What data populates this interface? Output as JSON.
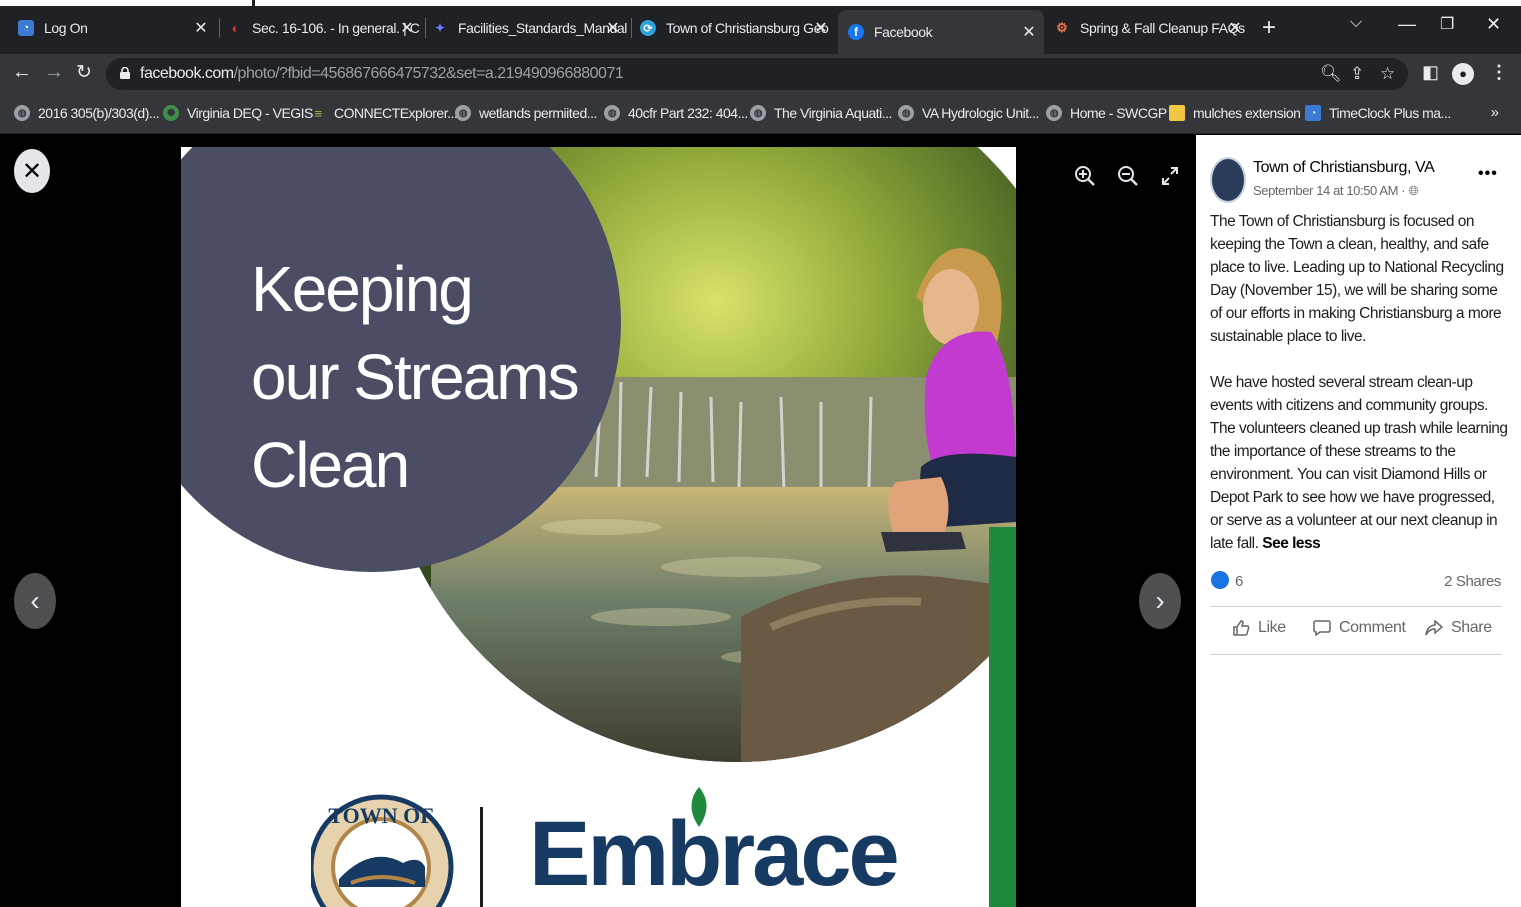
{
  "tabs": [
    {
      "label": "Log On",
      "favicon": "timeclock-icon",
      "active": false
    },
    {
      "label": "Sec. 16-106. - In general. | C",
      "favicon": "municode-icon",
      "active": false
    },
    {
      "label": "Facilities_Standards_Manual",
      "favicon": "document-icon",
      "active": false
    },
    {
      "label": "Town of Christiansburg Geo",
      "favicon": "geo-icon",
      "active": false
    },
    {
      "label": "Facebook",
      "favicon": "facebook-icon",
      "active": true
    },
    {
      "label": "Spring & Fall Cleanup FAQs",
      "favicon": "cleanup-icon",
      "active": false
    }
  ],
  "address": {
    "host": "facebook.com",
    "path": "/photo/?fbid=456867666475732&set=a.219490966880071"
  },
  "bookmarks": [
    {
      "label": "2016 305(b)/303(d)..."
    },
    {
      "label": "Virginia DEQ - VEGIS"
    },
    {
      "label": "CONNECTExplorer..."
    },
    {
      "label": "wetlands permiited..."
    },
    {
      "label": "40cfr Part 232: 404..."
    },
    {
      "label": "The Virginia Aquati..."
    },
    {
      "label": "VA Hydrologic Unit..."
    },
    {
      "label": "Home - SWCGP"
    },
    {
      "label": "mulches extension"
    },
    {
      "label": "TimeClock Plus ma..."
    }
  ],
  "photo": {
    "headline": [
      "Keeping",
      "our Streams",
      "Clean"
    ],
    "brand": "Embrace",
    "seal_text": "TOWN OF"
  },
  "post": {
    "page_name": "Town of Christiansburg, VA",
    "meta": "September 14 at 10:50 AM · ",
    "paragraph1": "The Town of Christiansburg is focused on keeping the Town a clean, healthy, and safe place to live. Leading up to National Recycling Day (November 15), we will be sharing some of our efforts in making Christiansburg a more sustainable place to live.",
    "paragraph2": "We have hosted several stream clean-up events with citizens and community groups. The volunteers cleaned up trash while learning the importance of these streams to the environment. You can visit Diamond Hills or Depot Park to see how we have progressed, or serve as a volunteer at our next cleanup in late fall.",
    "see_less": "See less",
    "like_count": "6",
    "shares": "2 Shares",
    "actions": {
      "like": "Like",
      "comment": "Comment",
      "share": "Share"
    }
  },
  "colors": {
    "chrome_dark": "#202124",
    "chrome_toolbar": "#35363a",
    "facebook_blue": "#1b74e4",
    "brand_navy": "#173a63",
    "brand_green": "#1f8a3b"
  }
}
